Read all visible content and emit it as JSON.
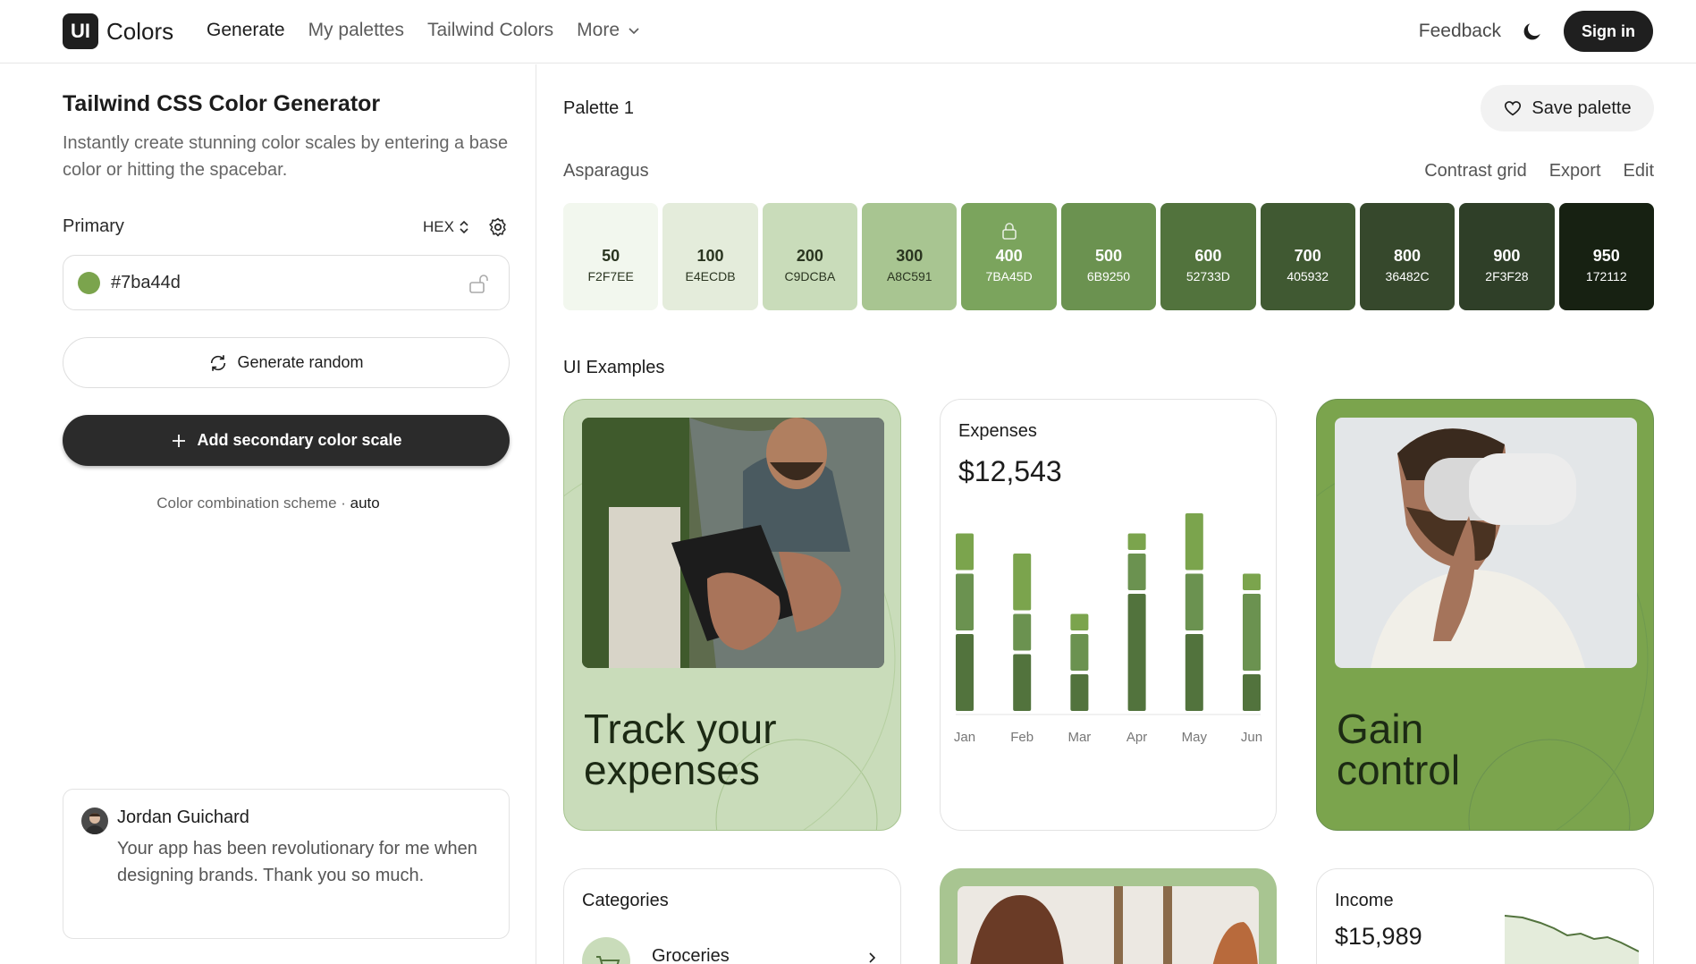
{
  "header": {
    "logo_mark": "UI",
    "logo_text": "Colors",
    "nav": [
      "Generate",
      "My palettes",
      "Tailwind Colors",
      "More"
    ],
    "feedback": "Feedback",
    "sign_in": "Sign in"
  },
  "left": {
    "title": "Tailwind CSS Color Generator",
    "description": "Instantly create stunning color scales by entering a base color or hitting the spacebar.",
    "primary_label": "Primary",
    "format": "HEX",
    "color_value": "#7ba44d",
    "generate_random": "Generate random",
    "add_secondary": "Add secondary color scale",
    "scheme_label": "Color combination scheme · ",
    "scheme_value": "auto",
    "testimonial": {
      "name": "Jordan Guichard",
      "quote": "Your app has been revolutionary for me when designing brands. Thank you so much."
    }
  },
  "palette": {
    "title": "Palette 1",
    "save": "Save palette",
    "name": "Asparagus",
    "actions": [
      "Contrast grid",
      "Export",
      "Edit"
    ],
    "shades": [
      {
        "num": "50",
        "hex": "F2F7EE",
        "color": "#f2f7ee",
        "text": "#2a3520"
      },
      {
        "num": "100",
        "hex": "E4ECDB",
        "color": "#e4ecdb",
        "text": "#2a3520"
      },
      {
        "num": "200",
        "hex": "C9DCBA",
        "color": "#c9dcba",
        "text": "#2a3520"
      },
      {
        "num": "300",
        "hex": "A8C591",
        "color": "#a8c591",
        "text": "#2a3520"
      },
      {
        "num": "400",
        "hex": "7BA45D",
        "color": "#7ba45d",
        "text": "#ffffff"
      },
      {
        "num": "500",
        "hex": "6B9250",
        "color": "#6b9250",
        "text": "#ffffff"
      },
      {
        "num": "600",
        "hex": "52733D",
        "color": "#52733d",
        "text": "#ffffff"
      },
      {
        "num": "700",
        "hex": "405932",
        "color": "#405932",
        "text": "#ffffff"
      },
      {
        "num": "800",
        "hex": "36482C",
        "color": "#36482c",
        "text": "#ffffff"
      },
      {
        "num": "900",
        "hex": "2F3F28",
        "color": "#2f3f28",
        "text": "#ffffff"
      },
      {
        "num": "950",
        "hex": "172112",
        "color": "#172112",
        "text": "#ffffff"
      }
    ]
  },
  "ui_examples": {
    "title": "UI Examples",
    "track_card": "Track your expenses",
    "gain_card": "Gain control",
    "expenses": {
      "label": "Expenses",
      "value": "$12,543"
    },
    "categories": {
      "label": "Categories",
      "item": "Groceries"
    },
    "income": {
      "label": "Income",
      "value": "$15,989"
    }
  },
  "chart_data": {
    "type": "bar",
    "categories": [
      "Jan",
      "Feb",
      "Mar",
      "Apr",
      "May",
      "Jun"
    ],
    "series": [
      {
        "values": [
          100,
          75,
          50,
          150,
          100,
          50
        ]
      },
      {
        "values": [
          75,
          50,
          50,
          50,
          75,
          100
        ]
      },
      {
        "values": [
          50,
          75,
          25,
          25,
          75,
          25
        ]
      }
    ],
    "colors": [
      "#52733d",
      "#6b9250",
      "#7ba44d"
    ]
  }
}
